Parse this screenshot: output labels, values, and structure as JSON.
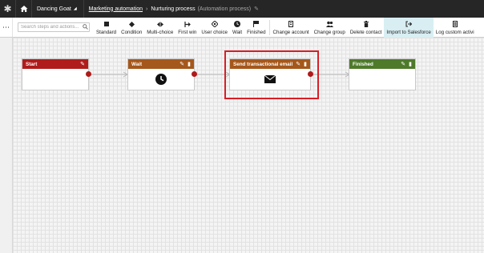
{
  "header": {
    "site_name": "Dancing Goat",
    "breadcrumb_app": "Marketing automation",
    "breadcrumb_item": "Nurturing process",
    "breadcrumb_type": "(Automation process)"
  },
  "toolbar": {
    "search_placeholder": "Search steps and actions...",
    "steps": [
      {
        "label": "Standard",
        "icon": "square-icon"
      },
      {
        "label": "Condition",
        "icon": "diamond-icon"
      },
      {
        "label": "Multi-choice",
        "icon": "multi-choice-icon"
      },
      {
        "label": "First win",
        "icon": "first-win-icon"
      },
      {
        "label": "User choice",
        "icon": "user-choice-icon"
      },
      {
        "label": "Wait",
        "icon": "clock-icon"
      },
      {
        "label": "Finished",
        "icon": "finished-icon"
      }
    ],
    "actions": [
      {
        "label": "Change account",
        "icon": "building-icon"
      },
      {
        "label": "Change group",
        "icon": "group-icon"
      },
      {
        "label": "Delete contact",
        "icon": "trash-icon"
      },
      {
        "label": "Import to Salesforce",
        "icon": "import-icon",
        "active": true
      },
      {
        "label": "Log custom activi",
        "icon": "log-icon"
      }
    ]
  },
  "workflow": {
    "nodes": [
      {
        "title": "Start",
        "color": "#b01c1c",
        "icon": ""
      },
      {
        "title": "Wait",
        "color": "#a5581b",
        "icon": "clock-icon"
      },
      {
        "title": "Send transactional email",
        "color": "#a5581b",
        "icon": "envelope-icon"
      },
      {
        "title": "Finished",
        "color": "#4e7a2a",
        "icon": ""
      }
    ]
  }
}
